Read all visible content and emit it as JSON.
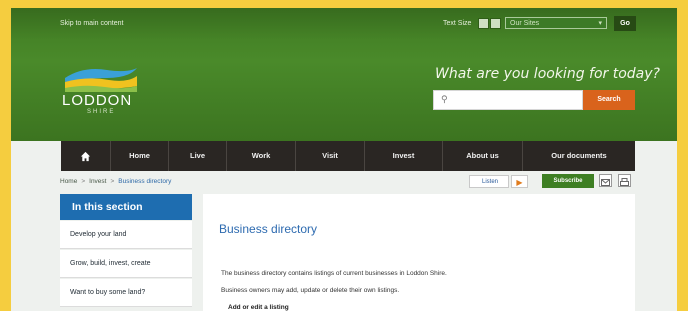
{
  "utility": {
    "skip_link": "Skip to main content",
    "text_size_label": "Text Size",
    "sites_select": "Our Sites",
    "go_label": "Go"
  },
  "brand": {
    "name": "LODDON",
    "sub": "SHIRE",
    "tagline": "What are you looking for today?"
  },
  "search": {
    "placeholder": "",
    "button_label": "Search"
  },
  "nav": {
    "items": [
      "Home",
      "Live",
      "Work",
      "Visit",
      "Invest",
      "About us",
      "Our documents"
    ]
  },
  "breadcrumb": {
    "items": [
      "Home",
      "Invest",
      "Business directory"
    ]
  },
  "tools": {
    "listen_label": "Listen",
    "subscribe_label": "Subscribe"
  },
  "sidebar": {
    "title": "In this section",
    "items": [
      "Develop your land",
      "Grow, build, invest, create",
      "Want to buy some land?"
    ]
  },
  "main": {
    "title": "Business directory",
    "para1": "The business directory contains listings of current businesses in Loddon Shire.",
    "para2": "Business owners may add, update or delete their own listings.",
    "link": "Add or edit a listing"
  },
  "colors": {
    "header_green": "#4a8a2a",
    "nav_dark": "#2a2623",
    "search_orange": "#d9631c",
    "sidebar_blue": "#1e6db0",
    "title_blue": "#2e6bb0",
    "page_border": "#f5cd3f"
  }
}
